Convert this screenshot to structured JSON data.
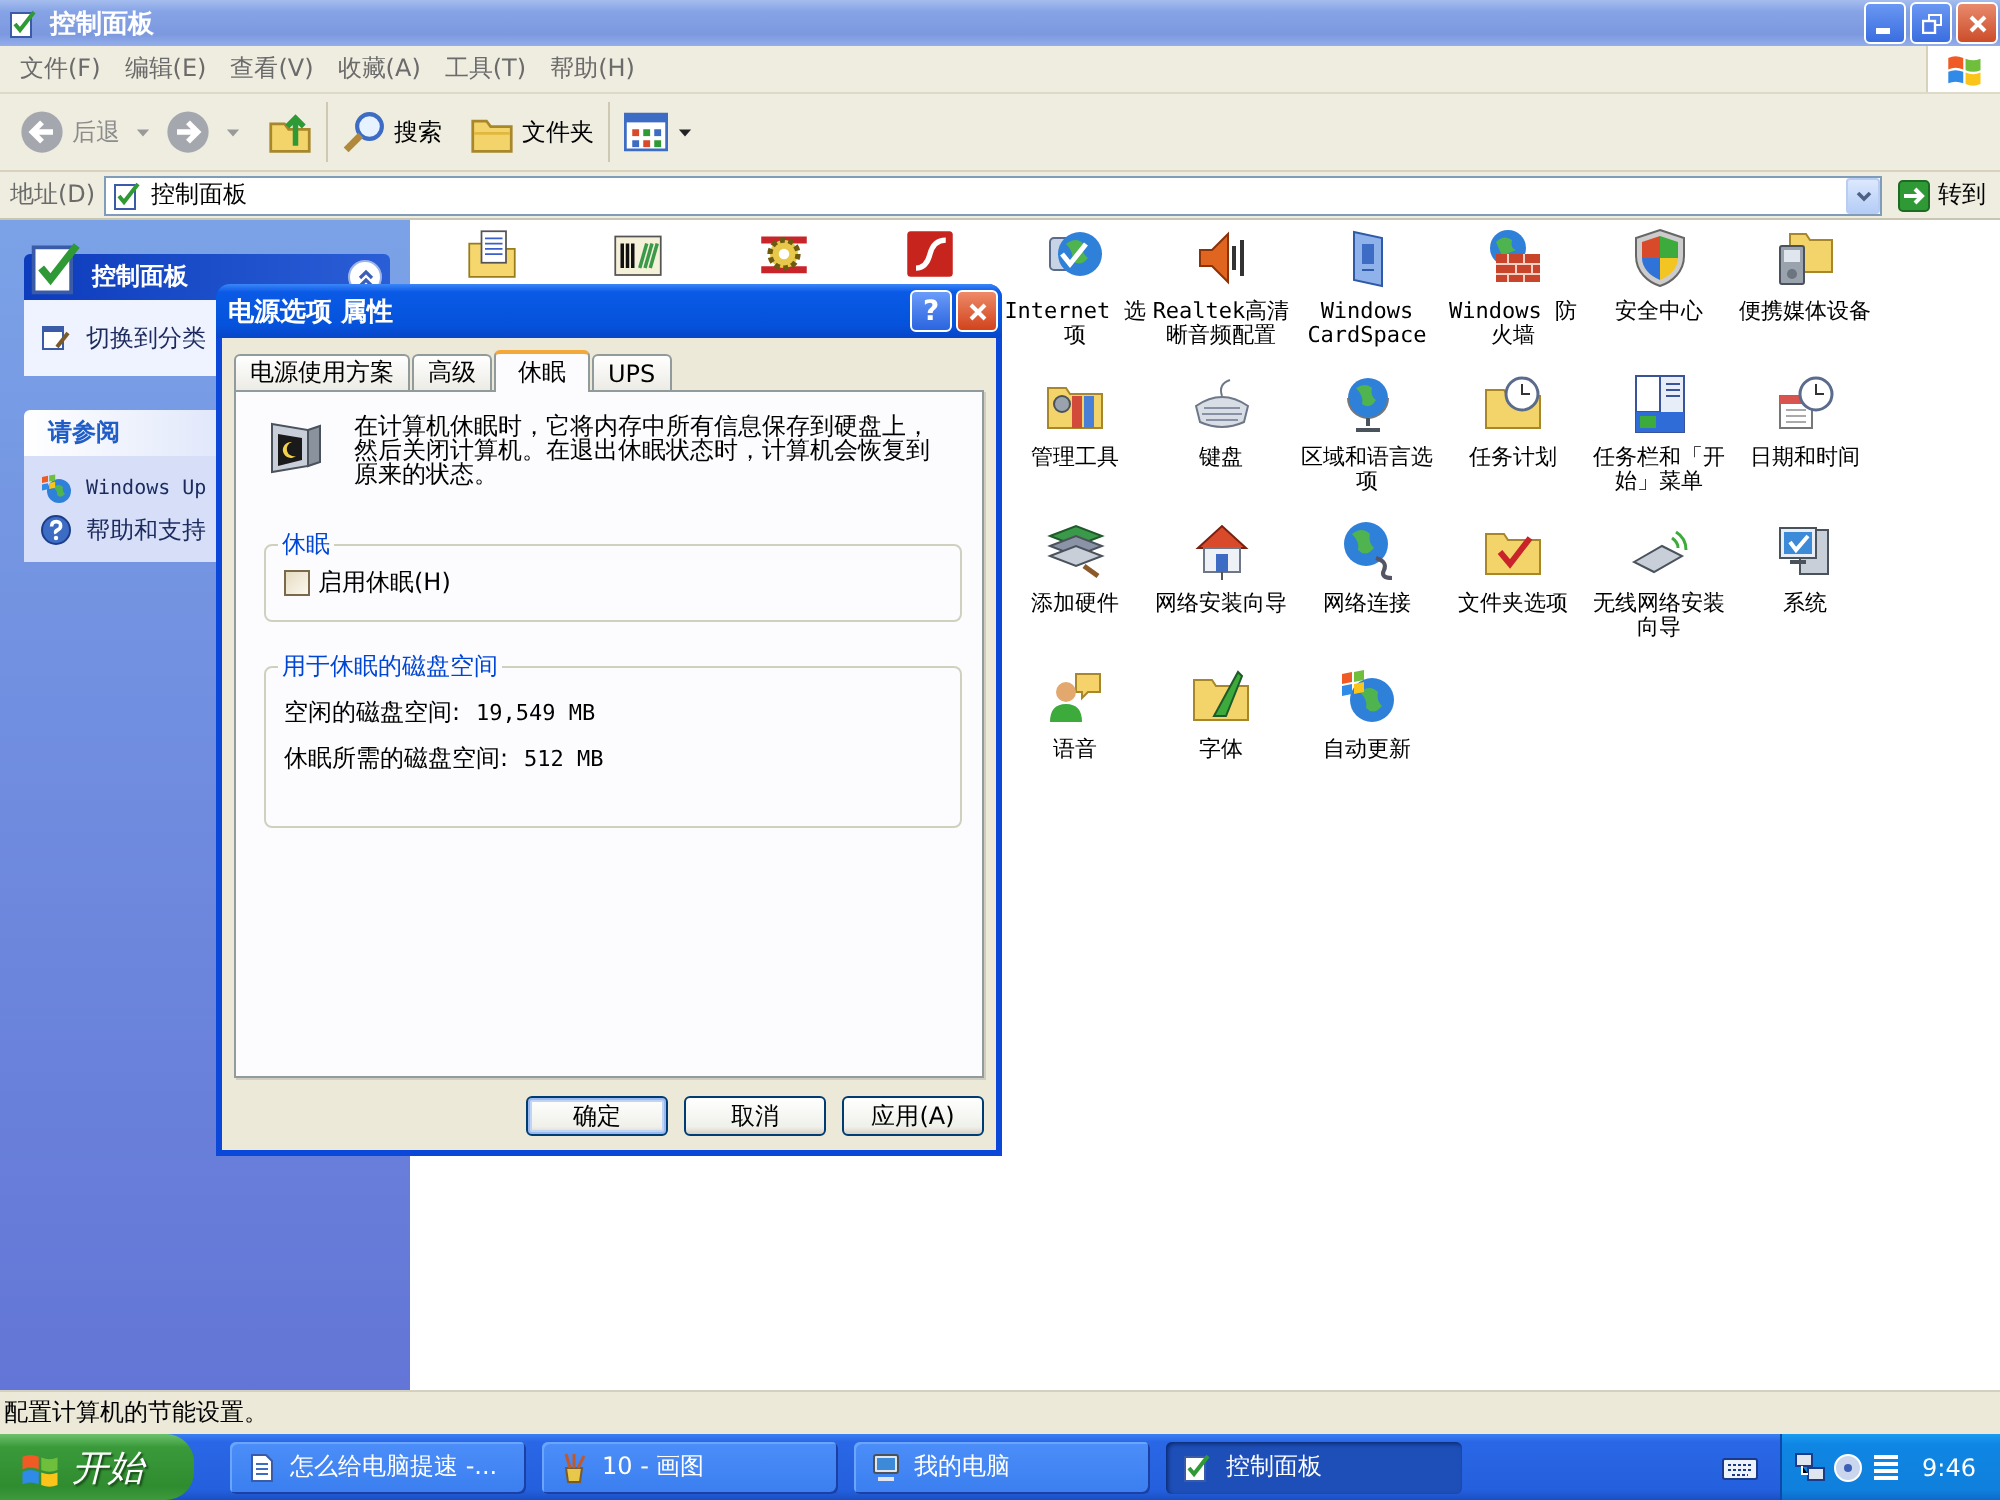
{
  "window": {
    "title": "控制面板",
    "active": false
  },
  "menu": [
    "文件(F)",
    "编辑(E)",
    "查看(V)",
    "收藏(A)",
    "工具(T)",
    "帮助(H)"
  ],
  "toolbar": {
    "back": {
      "label": "后退",
      "disabled": true
    },
    "forward": {
      "disabled": true
    },
    "search": {
      "label": "搜索"
    },
    "folders": {
      "label": "文件夹"
    }
  },
  "address": {
    "label": "地址(D)",
    "value": "控制面板",
    "go": "转到"
  },
  "sidebar": {
    "panels": [
      {
        "title": "控制面板",
        "kind": "special",
        "items": [
          "切换到分类"
        ]
      },
      {
        "title": "请参阅",
        "kind": "normal",
        "items": [
          "Windows Up",
          "帮助和支持"
        ]
      }
    ]
  },
  "content": {
    "rows": [
      [
        "Internet 选项",
        "Realtek高清晰音频配置",
        "Windows CardSpace",
        "Windows 防火墙",
        "安全中心",
        "便携媒体设备"
      ],
      [
        "管理工具",
        "键盘",
        "区域和语言选项",
        "任务计划",
        "任务栏和「开始」菜单",
        "日期和时间"
      ],
      [
        "添加硬件",
        "网络安装向导",
        "网络连接",
        "文件夹选项",
        "无线网络安装向导",
        "系统"
      ],
      [
        "语音",
        "字体",
        "自动更新"
      ]
    ]
  },
  "dialog": {
    "title": "电源选项 属性",
    "active": true,
    "help": "?",
    "tabs": [
      {
        "label": "电源使用方案",
        "selected": false
      },
      {
        "label": "高级",
        "selected": false
      },
      {
        "label": "休眠",
        "selected": true
      },
      {
        "label": "UPS",
        "selected": false
      }
    ],
    "description": "在计算机休眠时，它将内存中所有信息保存到硬盘上，然后关闭计算机。在退出休眠状态时，计算机会恢复到原来的状态。",
    "groups": [
      {
        "title": "休眠",
        "kind": "checkbox",
        "checkbox": {
          "label": "启用休眠(H)",
          "checked": false
        }
      },
      {
        "title": "用于休眠的磁盘空间",
        "kind": "info",
        "rows": [
          {
            "label": "空闲的磁盘空间:",
            "value": "19,549 MB"
          },
          {
            "label": "休眠所需的磁盘空间:",
            "value": "512 MB"
          }
        ]
      }
    ],
    "buttons": [
      {
        "label": "确定",
        "default": true
      },
      {
        "label": "取消",
        "default": false
      },
      {
        "label": "应用(A)",
        "default": false
      }
    ]
  },
  "status_bar": "配置计算机的节能设置。",
  "taskbar": {
    "start": "开始",
    "tasks": [
      {
        "label": "怎么给电脑提速 -...",
        "selected": false
      },
      {
        "label": "10 - 画图",
        "selected": false
      },
      {
        "label": "我的电脑",
        "selected": false
      },
      {
        "label": "控制面板",
        "selected": true
      }
    ],
    "clock": "9:46"
  }
}
